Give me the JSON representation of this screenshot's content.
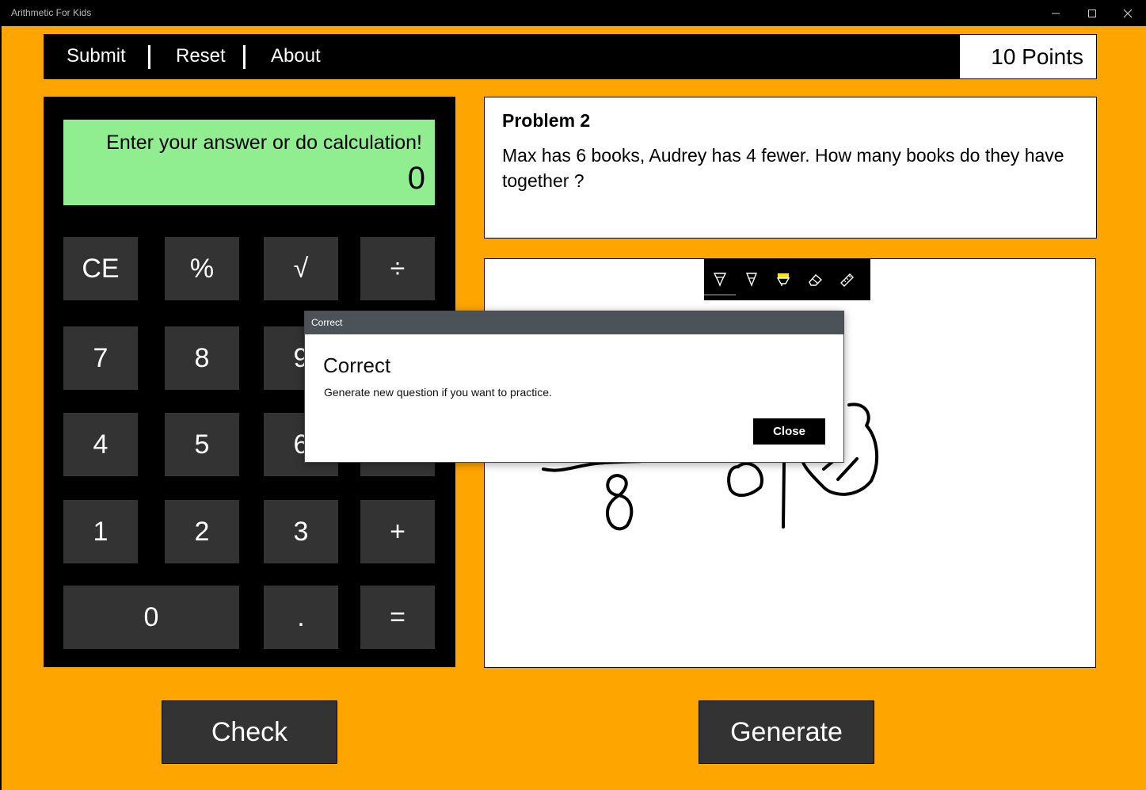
{
  "window": {
    "title": "Arithmetic For Kids"
  },
  "menu": {
    "submit": "Submit",
    "reset": "Reset",
    "about": "About",
    "separator": "|"
  },
  "points": "10 Points",
  "calculator": {
    "prompt": "Enter your answer or do calculation!",
    "value": "0",
    "keys": [
      "CE",
      "%",
      "√",
      "÷",
      "7",
      "8",
      "9",
      "×",
      "4",
      "5",
      "6",
      "−",
      "1",
      "2",
      "3",
      "+",
      "0",
      ".",
      "="
    ]
  },
  "problem": {
    "title": "Problem 2",
    "text": "Max has 6 books, Audrey has 4 fewer. How many books do they have together ?"
  },
  "ink_toolbar": {
    "tools": [
      "ballpoint-pen-icon",
      "pencil-icon",
      "highlighter-icon",
      "eraser-icon",
      "ruler-icon"
    ],
    "highlighter_color": "#FFE600"
  },
  "buttons": {
    "check": "Check",
    "generate": "Generate"
  },
  "dialog": {
    "window_title": "Correct",
    "heading": "Correct",
    "message": "Generate new question if you want to practice.",
    "close": "Close"
  },
  "colors": {
    "background": "#FFA500",
    "display": "#90EE90",
    "key": "#333333"
  }
}
